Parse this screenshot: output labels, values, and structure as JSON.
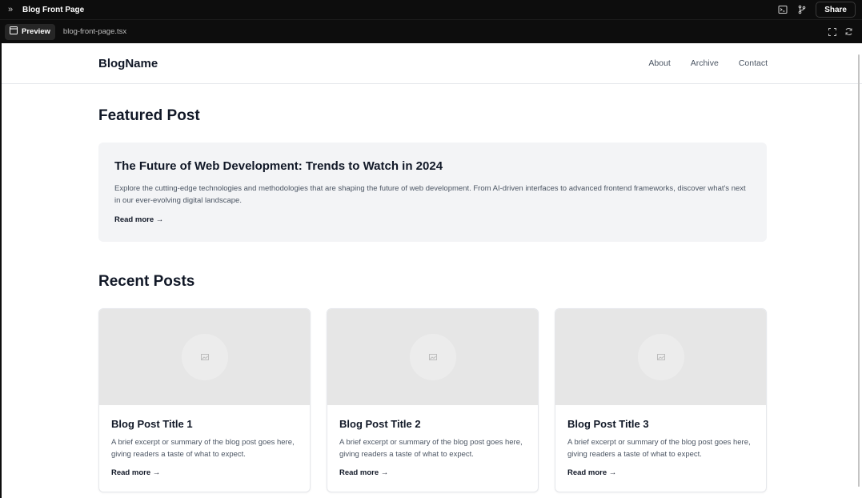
{
  "window": {
    "title": "Blog Front Page",
    "share_label": "Share"
  },
  "tabs": {
    "preview_label": "Preview",
    "file_name": "blog-front-page.tsx"
  },
  "site": {
    "logo": "BlogName",
    "nav": [
      "About",
      "Archive",
      "Contact"
    ]
  },
  "featured": {
    "section_title": "Featured Post",
    "title": "The Future of Web Development: Trends to Watch in 2024",
    "excerpt": "Explore the cutting-edge technologies and methodologies that are shaping the future of web development. From AI-driven interfaces to advanced frontend frameworks, discover what's next in our ever-evolving digital landscape.",
    "read_more": "Read more →"
  },
  "recent": {
    "section_title": "Recent Posts",
    "posts": [
      {
        "title": "Blog Post Title 1",
        "excerpt": "A brief excerpt or summary of the blog post goes here, giving readers a taste of what to expect.",
        "read_more": "Read more →"
      },
      {
        "title": "Blog Post Title 2",
        "excerpt": "A brief excerpt or summary of the blog post goes here, giving readers a taste of what to expect.",
        "read_more": "Read more →"
      },
      {
        "title": "Blog Post Title 3",
        "excerpt": "A brief excerpt or summary of the blog post goes here, giving readers a taste of what to expect.",
        "read_more": "Read more →"
      }
    ]
  },
  "colors": {
    "chrome_bg": "#0d0d0d",
    "featured_bg": "#f3f4f6",
    "image_placeholder": "#e6e6e6",
    "text_primary": "#111827",
    "text_secondary": "#4b5563"
  },
  "icons": {
    "sidebar_toggle": "chevrons-right-icon",
    "terminal": "terminal-icon",
    "branch": "git-branch-icon",
    "preview": "preview-window-icon",
    "fullscreen": "fullscreen-icon",
    "refresh": "refresh-icon",
    "image_placeholder": "image-icon"
  }
}
